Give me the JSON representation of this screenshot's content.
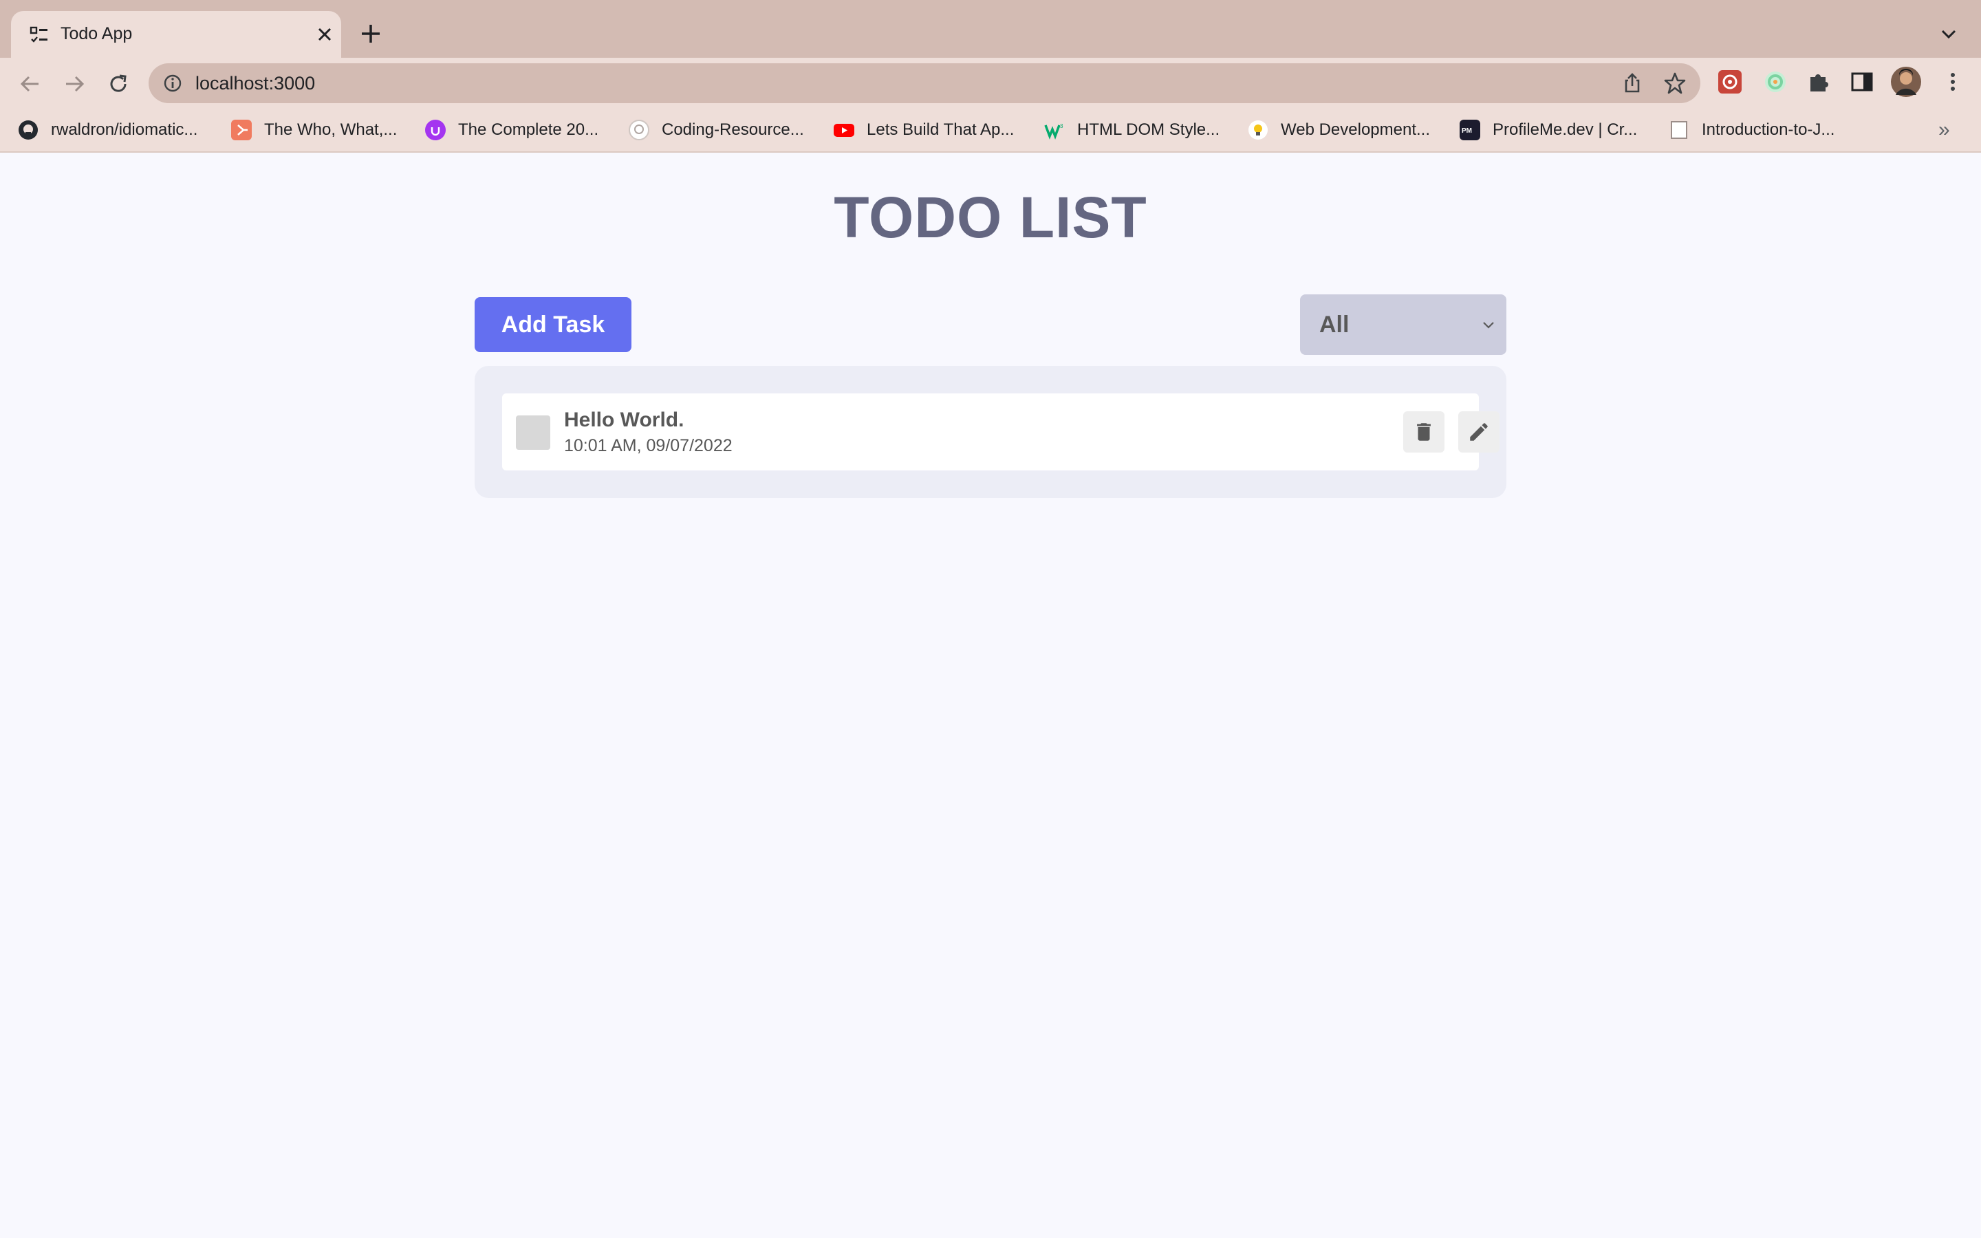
{
  "browser": {
    "tab_title": "Todo App",
    "url": "localhost:3000",
    "bookmarks": [
      {
        "label": "rwaldron/idiomatic...",
        "icon": "github-icon",
        "color": "#24292f"
      },
      {
        "label": "The Who, What,...",
        "icon": "hubspot-icon",
        "color": "#f07b5f"
      },
      {
        "label": "The Complete 20...",
        "icon": "udemy-icon",
        "color": "#a435f0"
      },
      {
        "label": "Coding-Resource...",
        "icon": "github-icon",
        "color": "#cfc6c2"
      },
      {
        "label": "Lets Build That Ap...",
        "icon": "youtube-icon",
        "color": "#ff0000"
      },
      {
        "label": "HTML DOM Style...",
        "icon": "w3schools-icon",
        "color": "#04aa6d"
      },
      {
        "label": "Web Development...",
        "icon": "lightbulb-icon",
        "color": "#f5c518"
      },
      {
        "label": "ProfileMe.dev | Cr...",
        "icon": "profileme-icon",
        "color": "#1c1c2e"
      },
      {
        "label": "Introduction-to-J...",
        "icon": "blank-page-icon",
        "color": "#ffffff"
      }
    ]
  },
  "app": {
    "title": "TODO LIST",
    "add_button_label": "Add Task",
    "filter": {
      "selected": "All"
    },
    "todos": [
      {
        "title": "Hello World.",
        "time": "10:01 AM, 09/07/2022",
        "completed": false
      }
    ]
  },
  "colors": {
    "accent": "#646ff0",
    "title": "#646681",
    "panel": "#ecedf6",
    "background": "#f8f8fe"
  }
}
